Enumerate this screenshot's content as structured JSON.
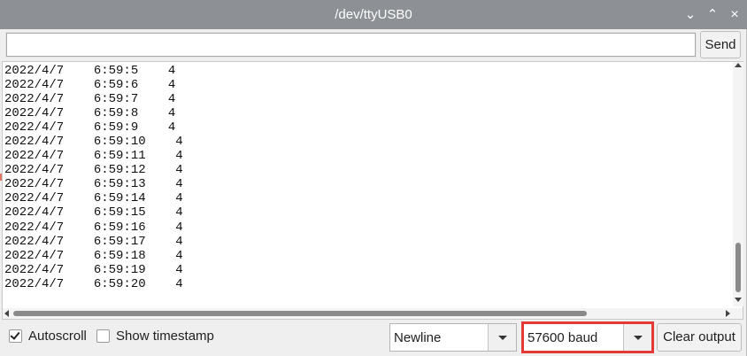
{
  "window": {
    "title": "/dev/ttyUSB0"
  },
  "titlebar_buttons": {
    "minimize": "⌄",
    "maximize": "⌃",
    "close": "×"
  },
  "send": {
    "input_value": "",
    "button_label": "Send"
  },
  "output": {
    "lines": [
      "2022/4/7    6:59:5    4",
      "2022/4/7    6:59:6    4",
      "2022/4/7    6:59:7    4",
      "2022/4/7    6:59:8    4",
      "2022/4/7    6:59:9    4",
      "2022/4/7    6:59:10    4",
      "2022/4/7    6:59:11    4",
      "2022/4/7    6:59:12    4",
      "2022/4/7    6:59:13    4",
      "2022/4/7    6:59:14    4",
      "2022/4/7    6:59:15    4",
      "2022/4/7    6:59:16    4",
      "2022/4/7    6:59:17    4",
      "2022/4/7    6:59:18    4",
      "2022/4/7    6:59:19    4",
      "2022/4/7    6:59:20    4"
    ]
  },
  "footer": {
    "autoscroll_label": "Autoscroll",
    "autoscroll_checked": true,
    "timestamp_label": "Show timestamp",
    "timestamp_checked": false,
    "line_ending": "Newline",
    "baud": "57600 baud",
    "clear_label": "Clear output"
  },
  "colors": {
    "titlebar": "#8d9095",
    "highlight": "#e53935"
  },
  "icons": {
    "minimize": "chevron-down-icon",
    "maximize": "chevron-up-icon",
    "close": "close-icon",
    "checkbox_checked": "checkmark-icon",
    "dropdown": "dropdown-arrow-icon"
  }
}
